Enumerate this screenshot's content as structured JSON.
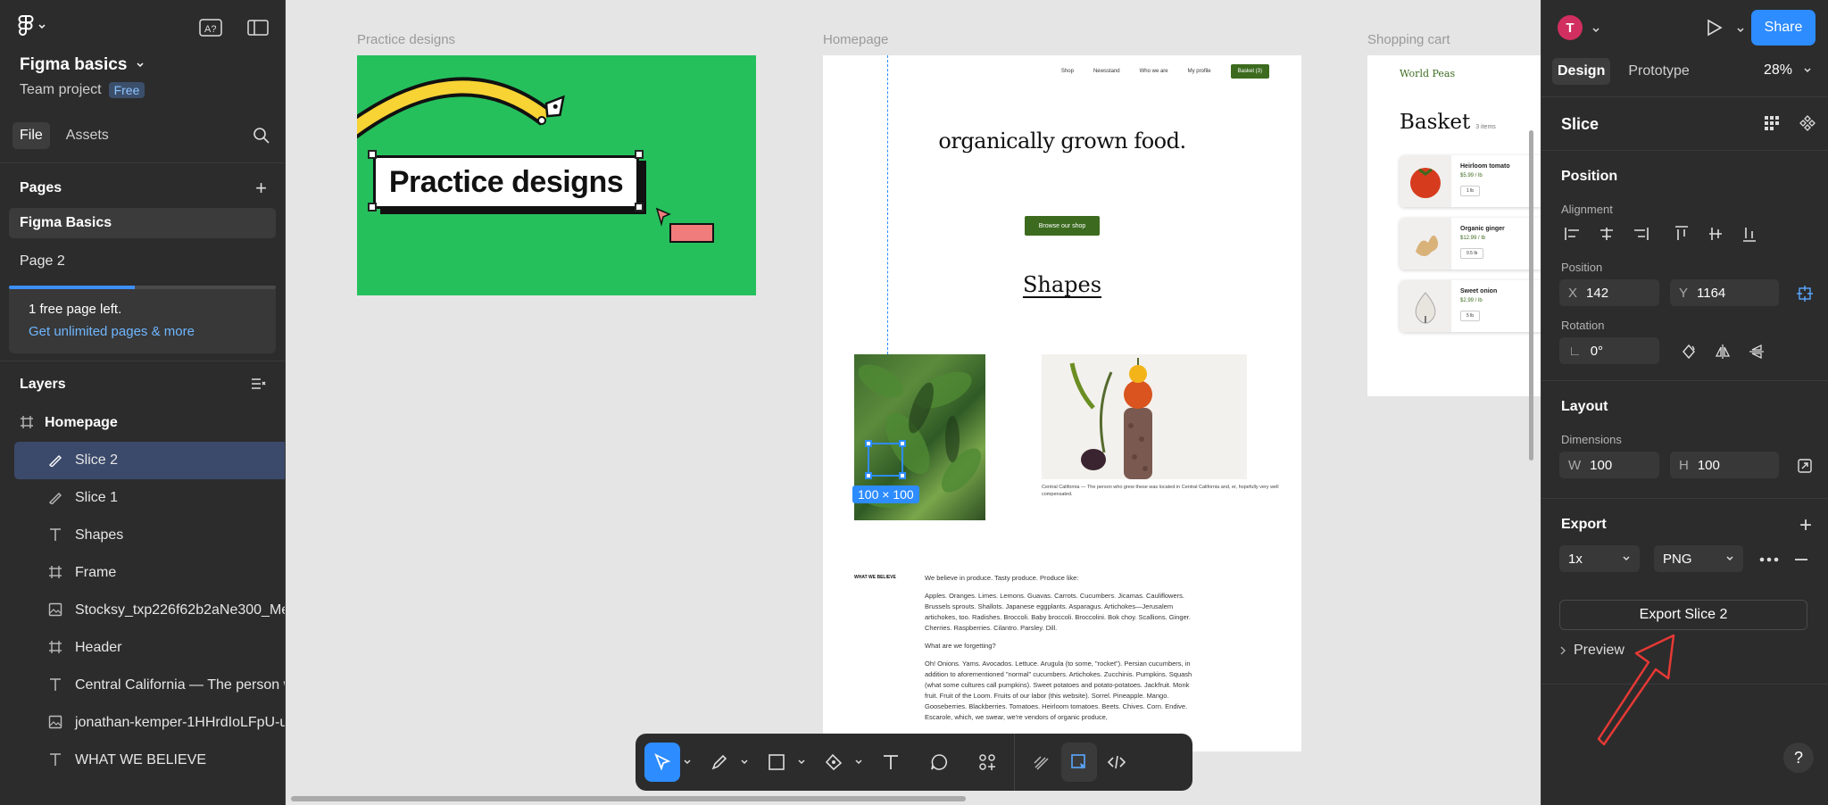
{
  "app": {
    "file_name": "Figma basics",
    "project": "Team project",
    "plan_badge": "Free"
  },
  "left_panel": {
    "tabs": [
      "File",
      "Assets"
    ],
    "pages_header": "Pages",
    "pages": [
      "Figma Basics",
      "Page 2"
    ],
    "page_limit_progress": 0.47,
    "upsell": {
      "line1": "1 free page left.",
      "link": "Get unlimited pages & more"
    },
    "layers_header": "Layers",
    "layers": [
      {
        "name": "Homepage",
        "type": "frame"
      },
      {
        "name": "Slice 2",
        "type": "slice"
      },
      {
        "name": "Slice 1",
        "type": "slice"
      },
      {
        "name": "Shapes",
        "type": "text"
      },
      {
        "name": "Frame",
        "type": "frame"
      },
      {
        "name": "Stocksy_txp226f62b2aNe300_Me",
        "type": "image"
      },
      {
        "name": "Header",
        "type": "frame"
      },
      {
        "name": "Central California — The person w",
        "type": "text"
      },
      {
        "name": "jonathan-kemper-1HHrdIoLFpU-u",
        "type": "image"
      },
      {
        "name": "WHAT WE BELIEVE",
        "type": "text"
      }
    ]
  },
  "canvas": {
    "frames": {
      "practice_label": "Practice designs",
      "practice_title": "Practice designs",
      "home_label": "Homepage",
      "cart_label": "Shopping cart"
    },
    "homepage": {
      "nav": [
        "Shop",
        "Newsstand",
        "Who we are",
        "My profile"
      ],
      "nav_cta": "Basket (3)",
      "hero": "organically grown food.",
      "browse_button": "Browse our shop",
      "shapes_heading": "Shapes",
      "caption": "Central California — The person who grew these was located in Central California and, er, hopefully very well compensated.",
      "what_we_believe": "WHAT WE BELIEVE",
      "body": [
        "We believe in produce. Tasty produce. Produce like:",
        "Apples. Oranges. Limes. Lemons. Guavas. Carrots. Cucumbers. Jicamas. Cauliflowers. Brussels sprouts. Shallots. Japanese eggplants. Asparagus. Artichokes—Jerusalem artichokes, too. Radishes. Broccoli. Baby broccoli. Broccolini. Bok choy. Scallions. Ginger. Cherries. Raspberries. Cilantro. Parsley. Dill.",
        "What are we forgetting?",
        "Oh! Onions. Yams. Avocados. Lettuce. Arugula (to some, \"rocket\"). Persian cucumbers, in addition to aforementioned \"normal\" cucumbers. Artichokes. Zucchinis. Pumpkins. Squash (what some cultures call pumpkins). Sweet potatoes and potato-potatoes. Jackfruit. Monk fruit. Fruit of the Loom. Fruits of our labor (this website). Sorrel. Pineapple. Mango. Gooseberries. Blackberries. Tomatoes. Heirloom tomatoes. Beets. Chives. Corn. Endive. Escarole, which, we swear, we're vendors of organic produce,"
      ],
      "selection_dimensions": "100 × 100"
    },
    "cart": {
      "brand": "World Peas",
      "title": "Basket",
      "count": "3 items",
      "items": [
        {
          "name": "Heirloom tomato",
          "price": "$5.99 / lb",
          "qty": "1 lb"
        },
        {
          "name": "Organic ginger",
          "price": "$12.99 / lb",
          "qty": "0.5 lb"
        },
        {
          "name": "Sweet onion",
          "price": "$2.99 / lb",
          "qty": "5 lb"
        }
      ]
    }
  },
  "toolbar": {
    "tools": [
      "move",
      "pencil",
      "frame",
      "pen",
      "text",
      "comment",
      "actions"
    ],
    "active_tool": "move"
  },
  "right_panel": {
    "avatar_initial": "T",
    "share": "Share",
    "tabs": [
      "Design",
      "Prototype"
    ],
    "zoom": "28%",
    "selection_type": "Slice",
    "position_header": "Position",
    "alignment_label": "Alignment",
    "position_label": "Position",
    "x_key": "X",
    "x_value": "142",
    "y_key": "Y",
    "y_value": "1164",
    "rotation_label": "Rotation",
    "rotation_value": "0°",
    "layout_header": "Layout",
    "dimensions_label": "Dimensions",
    "w_key": "W",
    "w_value": "100",
    "h_key": "H",
    "h_value": "100",
    "export_header": "Export",
    "export_scale": "1x",
    "export_format": "PNG",
    "export_button": "Export Slice 2",
    "preview_label": "Preview",
    "help": "?"
  },
  "colors": {
    "accent": "#2d8cff",
    "practice_bg": "#25c05c",
    "brand_green": "#3c6b1f",
    "annotation_arrow": "#e53935"
  }
}
